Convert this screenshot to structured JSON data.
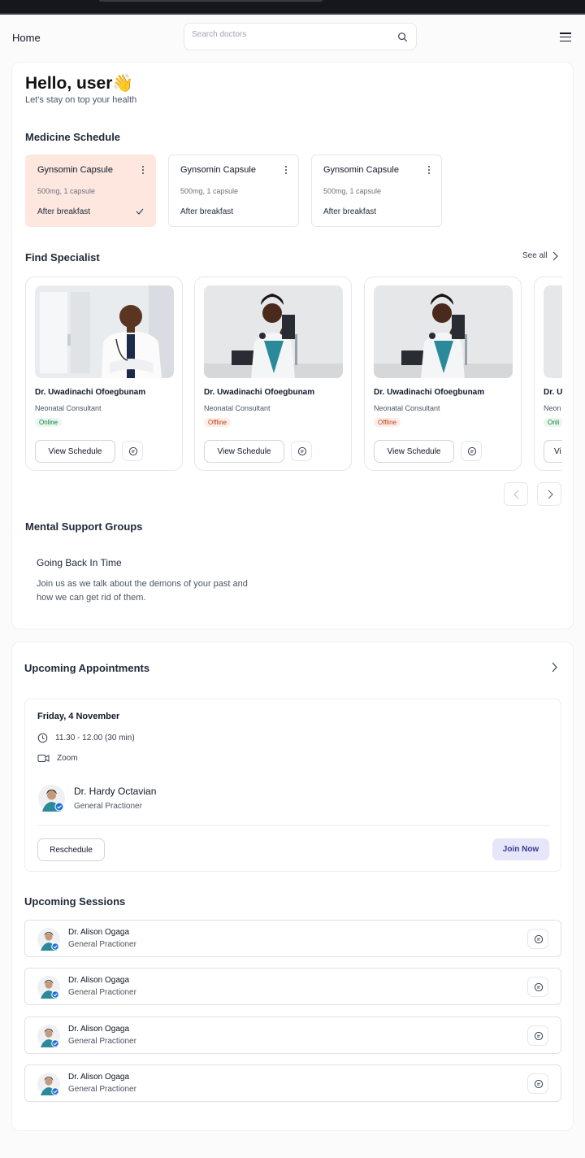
{
  "header": {
    "title": "Home",
    "search_placeholder": "Search doctors"
  },
  "greeting": {
    "title": "Hello, user👋",
    "subtitle": "Let's stay on top your health"
  },
  "medicine": {
    "heading": "Medicine Schedule",
    "items": [
      {
        "name": "Gynsomin Capsule",
        "dose": "500mg, 1 capsule",
        "when": "After breakfast",
        "done": true
      },
      {
        "name": "Gynsomin Capsule",
        "dose": "500mg, 1 capsule",
        "when": "After breakfast",
        "done": false
      },
      {
        "name": "Gynsomin Capsule",
        "dose": "500mg, 1 capsule",
        "when": "After breakfast",
        "done": false
      }
    ]
  },
  "specialists": {
    "heading": "Find Specialist",
    "see_all": "See all",
    "view_schedule": "View Schedule",
    "items": [
      {
        "name": "Dr. Uwadinachi Ofoegbunam",
        "role": "Neonatal Consultant",
        "status": "Online"
      },
      {
        "name": "Dr. Uwadinachi Ofoegbunam",
        "role": "Neonatal Consultant",
        "status": "Offline"
      },
      {
        "name": "Dr. Uwadinachi Ofoegbunam",
        "role": "Neonatal Consultant",
        "status": "Offline"
      },
      {
        "name": "Dr. U",
        "role": "Neon",
        "status": "Onli",
        "button": "Vi"
      }
    ]
  },
  "support": {
    "heading": "Mental Support Groups",
    "title": "Going Back In Time",
    "description": "Join us as we talk about the demons of your past and how we can get rid of them."
  },
  "appointments": {
    "heading": "Upcoming Appointments",
    "date": "Friday, 4 November",
    "time": "11.30 - 12.00 (30 min)",
    "platform": "Zoom",
    "doctor": "Dr. Hardy Octavian",
    "role": "General Practioner",
    "reschedule": "Reschedule",
    "join": "Join Now"
  },
  "sessions": {
    "heading": "Upcoming Sessions",
    "items": [
      {
        "name": "Dr. Alison Ogaga",
        "role": "General Practioner"
      },
      {
        "name": "Dr. Alison Ogaga",
        "role": "General Practioner"
      },
      {
        "name": "Dr. Alison Ogaga",
        "role": "General Practioner"
      },
      {
        "name": "Dr. Alison Ogaga",
        "role": "General Practioner"
      }
    ]
  },
  "colors": {
    "active_medicine_bg": "#fde7df",
    "online_badge": "#157a3c",
    "offline_badge": "#c2410c",
    "join_button_bg": "#e6e6fa",
    "verified_badge": "#1d6fe0"
  }
}
